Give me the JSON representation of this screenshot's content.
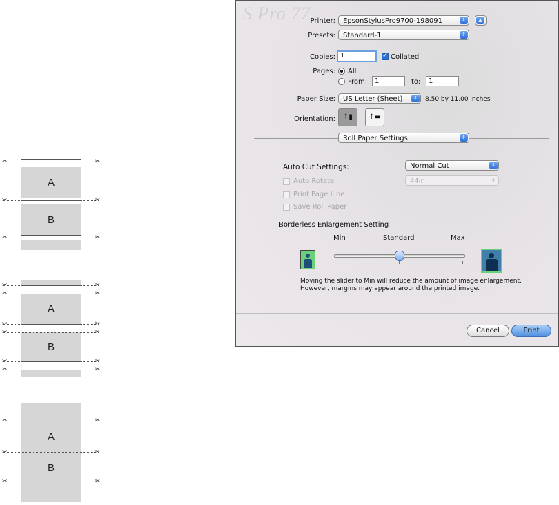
{
  "diagrams": [
    {
      "labels": [
        "A",
        "B"
      ]
    },
    {
      "labels": [
        "A",
        "B"
      ]
    },
    {
      "labels": [
        "A",
        "B"
      ]
    }
  ],
  "dialog": {
    "ghost_text": "S Pro 77",
    "printer": {
      "label": "Printer:",
      "value": "EpsonStylusPro9700-198091"
    },
    "presets": {
      "label": "Presets:",
      "value": "Standard-1"
    },
    "copies": {
      "label": "Copies:",
      "value": "1",
      "collated_label": "Collated",
      "collated": true
    },
    "pages": {
      "label": "Pages:",
      "all_label": "All",
      "from_label": "From:",
      "from_value": "1",
      "to_label": "to:",
      "to_value": "1",
      "selected": "All"
    },
    "paper_size": {
      "label": "Paper Size:",
      "value": "US Letter (Sheet)",
      "dimensions": "8.50 by 11.00 inches"
    },
    "orientation": {
      "label": "Orientation:",
      "selected": "portrait"
    },
    "section_popup": "Roll Paper Settings",
    "auto_cut": {
      "label": "Auto Cut Settings:",
      "value": "Normal Cut"
    },
    "auto_rotate": {
      "label": "Auto Rotate",
      "value": "44in",
      "enabled": false
    },
    "print_page_line": {
      "label": "Print Page Line",
      "enabled": false
    },
    "save_roll_paper": {
      "label": "Save Roll Paper",
      "enabled": false
    },
    "borderless": {
      "title": "Borderless Enlargement Setting",
      "min_label": "Min",
      "standard_label": "Standard",
      "max_label": "Max",
      "slider_position": "Standard",
      "note_line1": "Moving the slider to Min will reduce the amount of image enlargement.",
      "note_line2": "However, margins may appear around the printed image."
    },
    "buttons": {
      "cancel": "Cancel",
      "print": "Print"
    }
  }
}
